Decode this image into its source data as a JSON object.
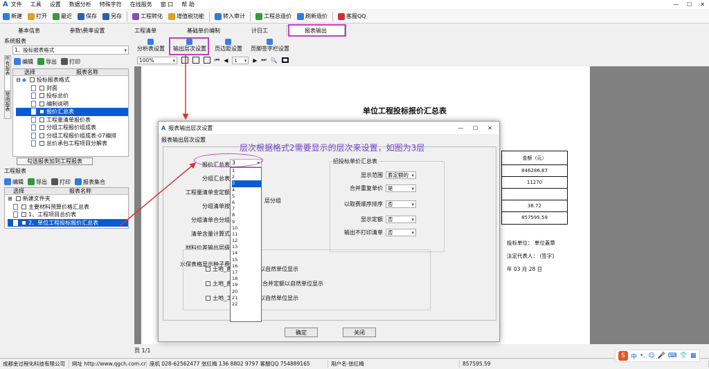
{
  "menu": [
    "文件",
    "工具",
    "设置",
    "数据分析",
    "特殊字符",
    "在线服务",
    "窗 口",
    "帮 助"
  ],
  "toolbar": [
    "新建",
    "打开",
    "最近",
    "保存",
    "另存",
    "工程转化",
    "增值税功能",
    "转入审计",
    "工程总造价",
    "刷新造价",
    "客服QQ"
  ],
  "tabs": [
    "基本信息",
    "参数\\费率设置",
    "工程清单",
    "基础单价编制",
    "计日工",
    "报表输出"
  ],
  "sys": {
    "title": "系统报表",
    "combo": "1、投标报表格式",
    "side": [
      "所有报表",
      "常用报表"
    ],
    "actions": [
      "编辑",
      "导出",
      "打印"
    ],
    "cols": [
      "选择",
      "报表名称"
    ],
    "items": [
      "投标报表格式",
      "封面",
      "投标总价",
      "编制说明",
      "报价汇总表",
      "工程量清单报价表",
      "分组工程报价组成表",
      "分组工程报价组成表-07编排",
      "总价承包工程项目分解表"
    ],
    "add_btn": "勾选报表加到工程报表"
  },
  "proj": {
    "title": "工程报表",
    "actions": [
      "编辑",
      "导出",
      "打印",
      "报表集合"
    ],
    "cols": [
      "选择",
      "报表名称"
    ],
    "items": [
      "新建文件夹",
      "主要材料预算价格汇总表",
      "1、工程项目总价表",
      "2、单位工程投标报价汇总表"
    ]
  },
  "rtool": [
    "分析表设置",
    "输出层次设置",
    "页边距设置",
    "页脚签字栏设置"
  ],
  "zoom": "100%",
  "pagenum": "1",
  "report": {
    "title": "单位工程投标报价汇总表",
    "amount_head": "金额（元）",
    "amounts": [
      "846286.87",
      "11270",
      "",
      "38.72",
      "857595.59"
    ],
    "sig": [
      "投标单位：  单位盖章",
      "法定代表人： (签字)",
      "年   03  月  28  日"
    ]
  },
  "page_label": "页 1/1",
  "dialog": {
    "title": "报表输出层次设置",
    "tab": "报表输出层次设置",
    "labels": [
      "报价汇总表",
      "分组汇总表",
      "工程量清单金定额",
      "分组清单按",
      "分组清单合分组",
      "清单含量计算式",
      "材料价差输出层级",
      "水保表格显示种子费"
    ],
    "combo_val": "3",
    "list": [
      "1",
      "2",
      "3",
      "4",
      "5",
      "6",
      "7",
      "8",
      "9",
      "10",
      "11",
      "12",
      "13",
      "14",
      "15",
      "16",
      "17",
      "18",
      "19",
      "20",
      "21",
      "22"
    ],
    "layer_group": "层分组",
    "group_title": "招投标单价汇总表",
    "rows": [
      {
        "label": "显示范围",
        "val": "套定额的"
      },
      {
        "label": "合并重复单价",
        "val": "是"
      },
      {
        "label": "以取费顺序排序",
        "val": "否"
      },
      {
        "label": "显示定额",
        "val": "否"
      },
      {
        "label": "输出不打印清单",
        "val": "否"
      }
    ],
    "checks": [
      "土地_直接费表定额以自然单位显示",
      "土地_直接费表_附项合并定额以自然单位显示",
      "土地_工程量表定额以自然单位显示"
    ],
    "ok": "确定",
    "close": "关闭"
  },
  "annot": "层次根据格式2需要显示的层次来设置，如图为3层",
  "status": [
    "成都金过程化科技有限公司",
    "网址 http://www.qgch.com.cn/",
    "座机 028-62562477 张红梅 136 8802 9797 客服QQ 754889165",
    "用户名-张红梅",
    "857595.59"
  ],
  "colors": {
    "accent": "#0a5bd3",
    "annot": "#7040c8",
    "arrow": "#e03030",
    "highlight": "#c040c0"
  }
}
